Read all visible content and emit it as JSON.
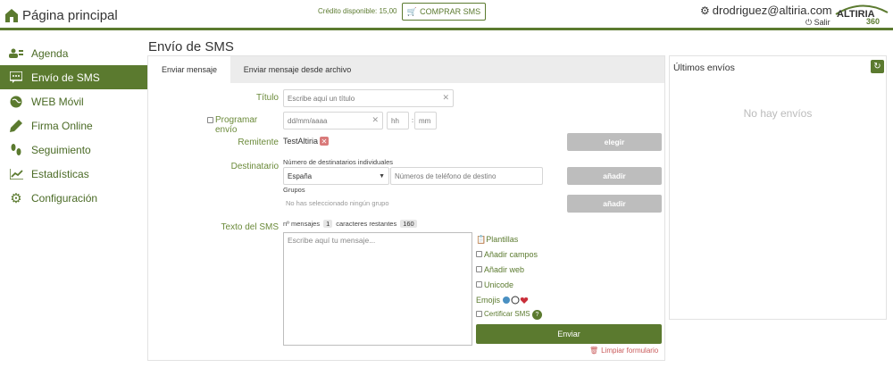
{
  "header": {
    "home_label": "Página principal",
    "credit_text": "Crédito disponible: 15,00",
    "buy_label": "COMPRAR SMS",
    "user_email": "drodriguez@altiria.com",
    "logout_label": "Salir",
    "logo_text": "ALTIRIA",
    "logo_sub": "360"
  },
  "sidebar": {
    "items": [
      {
        "label": "Agenda",
        "icon": "contacts-icon"
      },
      {
        "label": "Envío de SMS",
        "icon": "sms-icon"
      },
      {
        "label": "WEB Móvil",
        "icon": "globe-icon"
      },
      {
        "label": "Firma Online",
        "icon": "pen-icon"
      },
      {
        "label": "Seguimiento",
        "icon": "footprints-icon"
      },
      {
        "label": "Estadísticas",
        "icon": "chart-icon"
      },
      {
        "label": "Configuración",
        "icon": "gear-icon"
      }
    ]
  },
  "main": {
    "page_title": "Envío de SMS",
    "tabs": [
      {
        "label": "Enviar mensaje"
      },
      {
        "label": "Enviar mensaje desde archivo"
      }
    ],
    "form": {
      "title_label": "Título",
      "title_placeholder": "Escribe aquí un título",
      "schedule_label": "Programar envío",
      "date_placeholder": "dd/mm/aaaa",
      "hour_placeholder": "hh",
      "minute_placeholder": "mm",
      "time_sep": ":",
      "sender_label": "Remitente",
      "sender_value": "TestAltiria",
      "choose_label": "elegir",
      "recipient_label": "Destinatario",
      "individual_label": "Número de destinatarios individuales",
      "country_value": "España",
      "phone_placeholder": "Números de teléfono de destino",
      "add_label": "añadir",
      "groups_label": "Grupos",
      "groups_empty": "No has seleccionado ningún grupo",
      "add_group_label": "añadir",
      "text_label": "Texto del SMS",
      "messages_label": "nº mensajes",
      "messages_count": "1",
      "remaining_label": "caracteres restantes",
      "remaining_count": "160",
      "message_placeholder": "Escribe aquí tu mensaje...",
      "templates_label": "Plantillas",
      "add_fields_label": "Añadir campos",
      "add_web_label": "Añadir web",
      "unicode_label": "Unicode",
      "emojis_label": "Emojis",
      "certify_label": "Certificar SMS",
      "help_label": "?",
      "send_label": "Enviar",
      "clear_label": "Limpiar formulario"
    }
  },
  "recent": {
    "title": "Últimos envíos",
    "empty_text": "No hay envíos"
  }
}
